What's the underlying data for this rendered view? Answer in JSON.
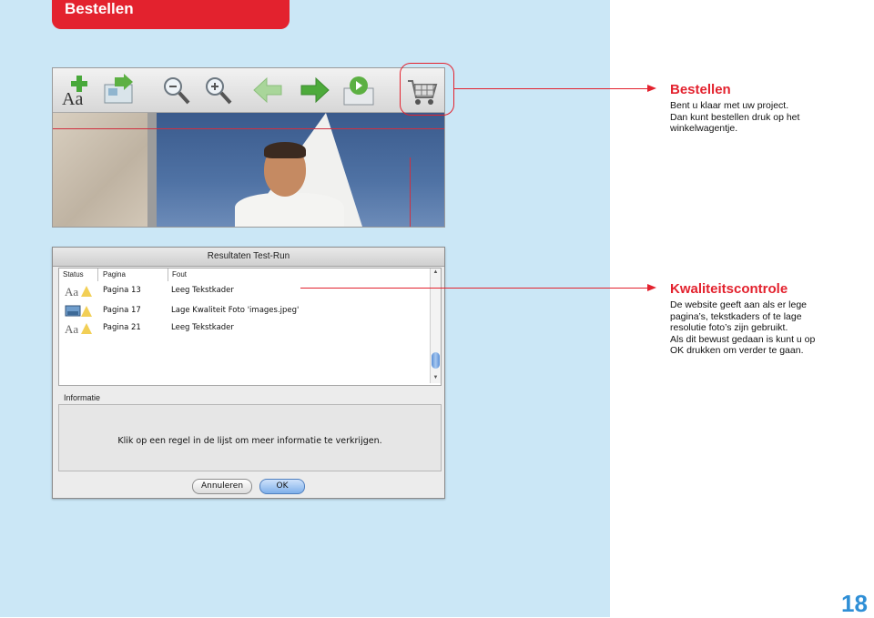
{
  "header": {
    "title": "Bestellen"
  },
  "toolbar": {
    "icons": [
      "add-text-icon",
      "import-photos-icon",
      "zoom-out-icon",
      "zoom-in-icon",
      "back-arrow-icon",
      "forward-arrow-icon",
      "preview-icon",
      "cart-icon"
    ]
  },
  "dialog": {
    "title": "Resultaten Test-Run",
    "columns": [
      "Status",
      "Pagina",
      "Fout"
    ],
    "rows": [
      {
        "page": "Pagina 13",
        "error": "Leeg Tekstkader"
      },
      {
        "page": "Pagina 17",
        "error": "Lage Kwaliteit Foto 'images.jpeg'"
      },
      {
        "page": "Pagina 21",
        "error": "Leeg Tekstkader"
      }
    ],
    "info_label": "Informatie",
    "info_text": "Klik op een regel in de lijst om meer informatie te verkrijgen.",
    "cancel_label": "Annuleren",
    "ok_label": "OK"
  },
  "callouts": {
    "bestellen": {
      "title": "Bestellen",
      "lines": [
        "Bent u klaar met uw project.",
        "Dan kunt bestellen druk op het",
        "winkelwagentje."
      ]
    },
    "kwaliteit": {
      "title": "Kwaliteitscontrole",
      "lines": [
        "De website geeft aan als er lege",
        "pagina’s, tekstkaders of te lage",
        "resolutie foto’s zijn gebruikt.",
        "Als dit bewust gedaan is kunt u op",
        "OK drukken om verder te gaan."
      ]
    }
  },
  "page_number": "18",
  "colors": {
    "accent": "#e3222e",
    "panel": "#cbe7f6",
    "page_number": "#2f8fd6"
  }
}
